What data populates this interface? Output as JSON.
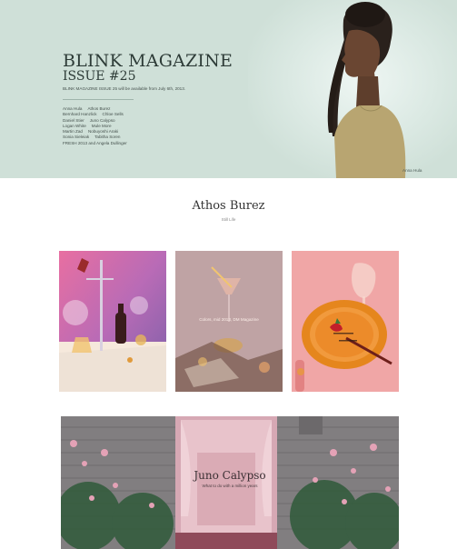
{
  "hero": {
    "title": "BLINK MAGAZINE",
    "issue": "ISSUE #25",
    "availability": "BLINK MAGAZINE ISSUE 25 will be available from July 6th, 2013.",
    "credit_rows": [
      [
        "Anna Hula",
        "Athos Burez"
      ],
      [
        "Bernhard Hanzlick",
        "Chloe Sells"
      ],
      [
        "Daniel Stier",
        "Juno Calypso"
      ],
      [
        "Logan White",
        "Mule More"
      ],
      [
        "Martin Zad",
        "Nobuyoshi Araki"
      ],
      [
        "Sonia Sieleiak",
        "Tabitha Soren"
      ],
      [
        "FRESH 2013 and Angela Dullinger"
      ]
    ],
    "photo_credit": "Anna Hula"
  },
  "section": {
    "title": "Athos Burez",
    "subtitle": "Still Life"
  },
  "cards": [
    {
      "caption": ""
    },
    {
      "caption": "Colors, mid 2013, DM Magazine"
    },
    {
      "caption": ""
    }
  ],
  "feature": {
    "title": "Juno Calypso",
    "subtitle": "What to do with a million years"
  },
  "colors": {
    "hero_bg": "#cfe0d8",
    "page_bg": "#ffffff",
    "text_dark": "#2d3b37"
  }
}
